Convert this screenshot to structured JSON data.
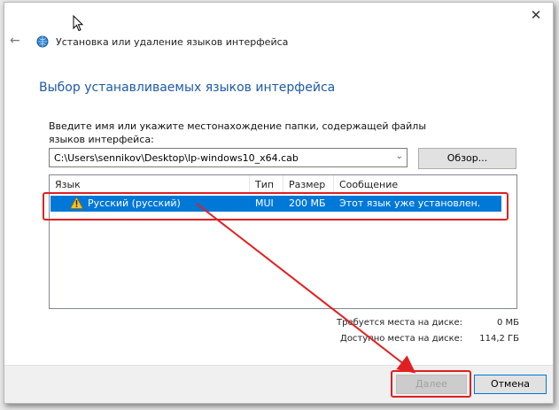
{
  "window": {
    "nav_title": "Установка или удаление языков интерфейса",
    "heading": "Выбор устанавливаемых языков интерфейса",
    "instruction": "Введите имя или укажите местонахождение папки, содержащей файлы языков интерфейса:"
  },
  "path_input": {
    "value": "C:\\Users\\sennikov\\Desktop\\lp-windows10_x64.cab"
  },
  "browse_label": "Обзор...",
  "list": {
    "columns": [
      "Язык",
      "Тип",
      "Размер",
      "Сообщение"
    ],
    "rows": [
      {
        "language": "Русский (русский)",
        "type": "MUI",
        "size": "200 МБ",
        "message": "Этот язык уже установлен."
      }
    ]
  },
  "disk": {
    "required_label": "Требуется места на диске:",
    "required_value": "0 МБ",
    "available_label": "Доступно места на диске:",
    "available_value": "114,2 ГБ"
  },
  "buttons": {
    "next": "Далее",
    "cancel": "Отмена"
  },
  "colors": {
    "heading": "#1e5aa8",
    "selection": "#0078d7",
    "annotation": "#e02020"
  }
}
